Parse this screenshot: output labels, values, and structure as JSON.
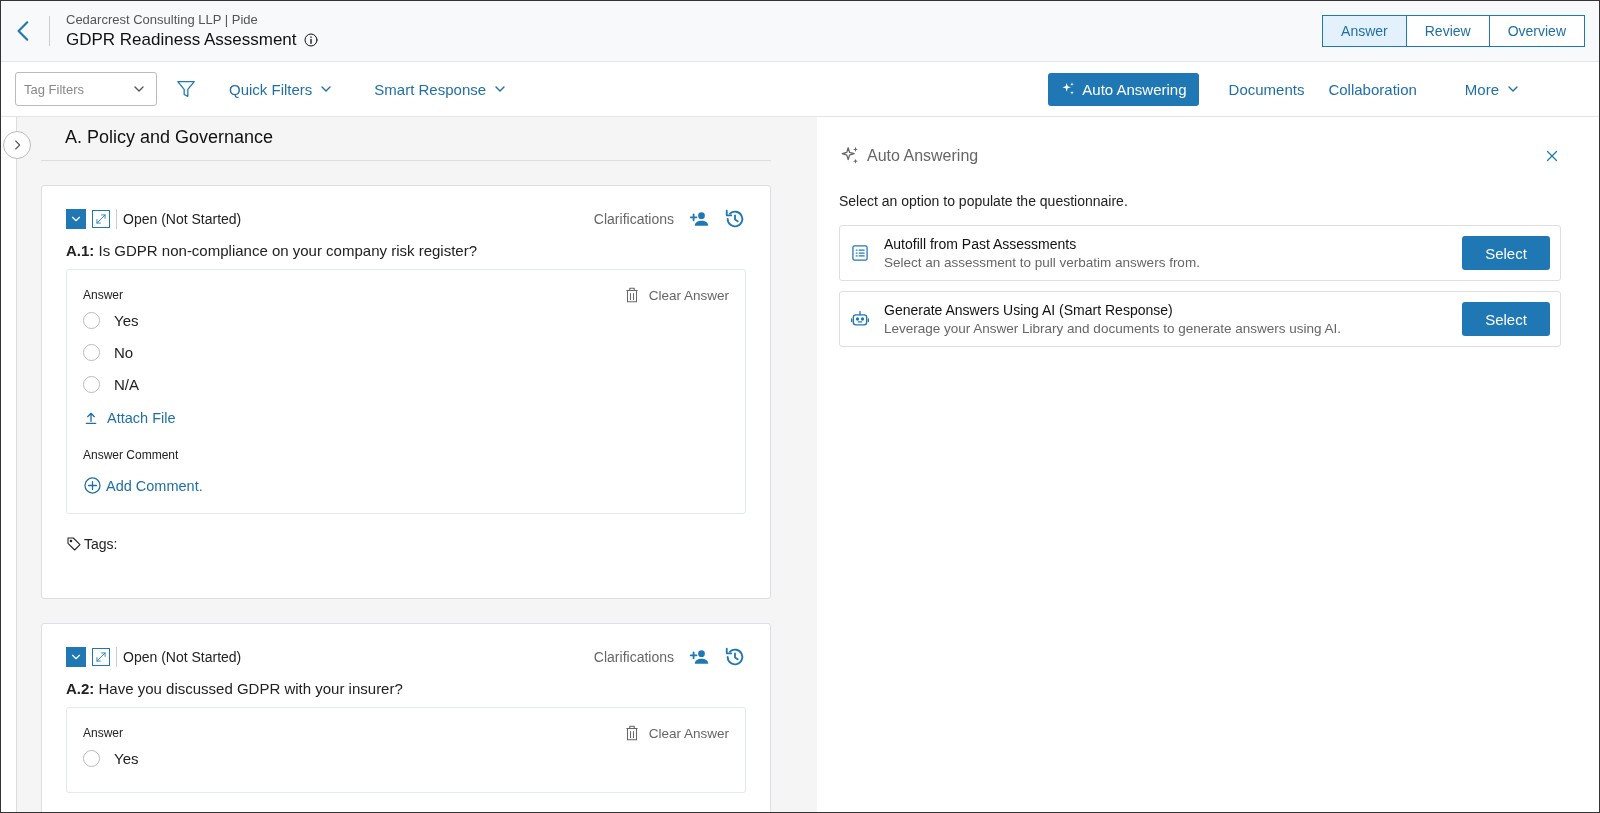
{
  "header": {
    "organization": "Cedarcrest Consulting LLP | Pide",
    "title": "GDPR Readiness Assessment",
    "view_tabs": [
      {
        "label": "Answer",
        "selected": true
      },
      {
        "label": "Review",
        "selected": false
      },
      {
        "label": "Overview",
        "selected": false
      }
    ]
  },
  "toolbar": {
    "tag_filter": {
      "placeholder": "Tag Filters"
    },
    "menus": [
      "Quick Filters",
      "Smart Response"
    ],
    "primary_button": "Auto Answering",
    "links": [
      "Documents",
      "Collaboration"
    ],
    "more_menu": "More"
  },
  "section": {
    "title": "A. Policy and Governance",
    "questions": [
      {
        "expanded": true,
        "status": "Open (Not Started)",
        "clarifications": "Clarifications",
        "number": "A.1:",
        "text": "Is GDPR non-compliance on your company risk register?",
        "answer_label": "Answer",
        "clear_label": "Clear Answer",
        "options": [
          {
            "label": "Yes",
            "selected": false
          },
          {
            "label": "No",
            "selected": false
          },
          {
            "label": "N/A",
            "selected": false
          }
        ],
        "attach_label": "Attach File",
        "comment_label": "Answer Comment",
        "add_comment": "Add Comment.",
        "tags_label": "Tags:"
      },
      {
        "expanded": true,
        "status": "Open (Not Started)",
        "clarifications": "Clarifications",
        "number": "A.2:",
        "text": "Have you discussed GDPR with your insurer?",
        "answer_label": "Answer",
        "clear_label": "Clear Answer",
        "options": [
          {
            "label": "Yes",
            "selected": false
          }
        ]
      }
    ]
  },
  "auto_panel": {
    "title": "Auto Answering",
    "intro": "Select an option to populate the questionnaire.",
    "options": [
      {
        "title": "Autofill from Past Assessments",
        "description": "Select an assessment to pull verbatim answers from.",
        "button": "Select"
      },
      {
        "title": "Generate Answers Using AI (Smart Response)",
        "description": "Leverage your Answer Library and documents to generate answers using AI.",
        "button": "Select"
      }
    ]
  }
}
